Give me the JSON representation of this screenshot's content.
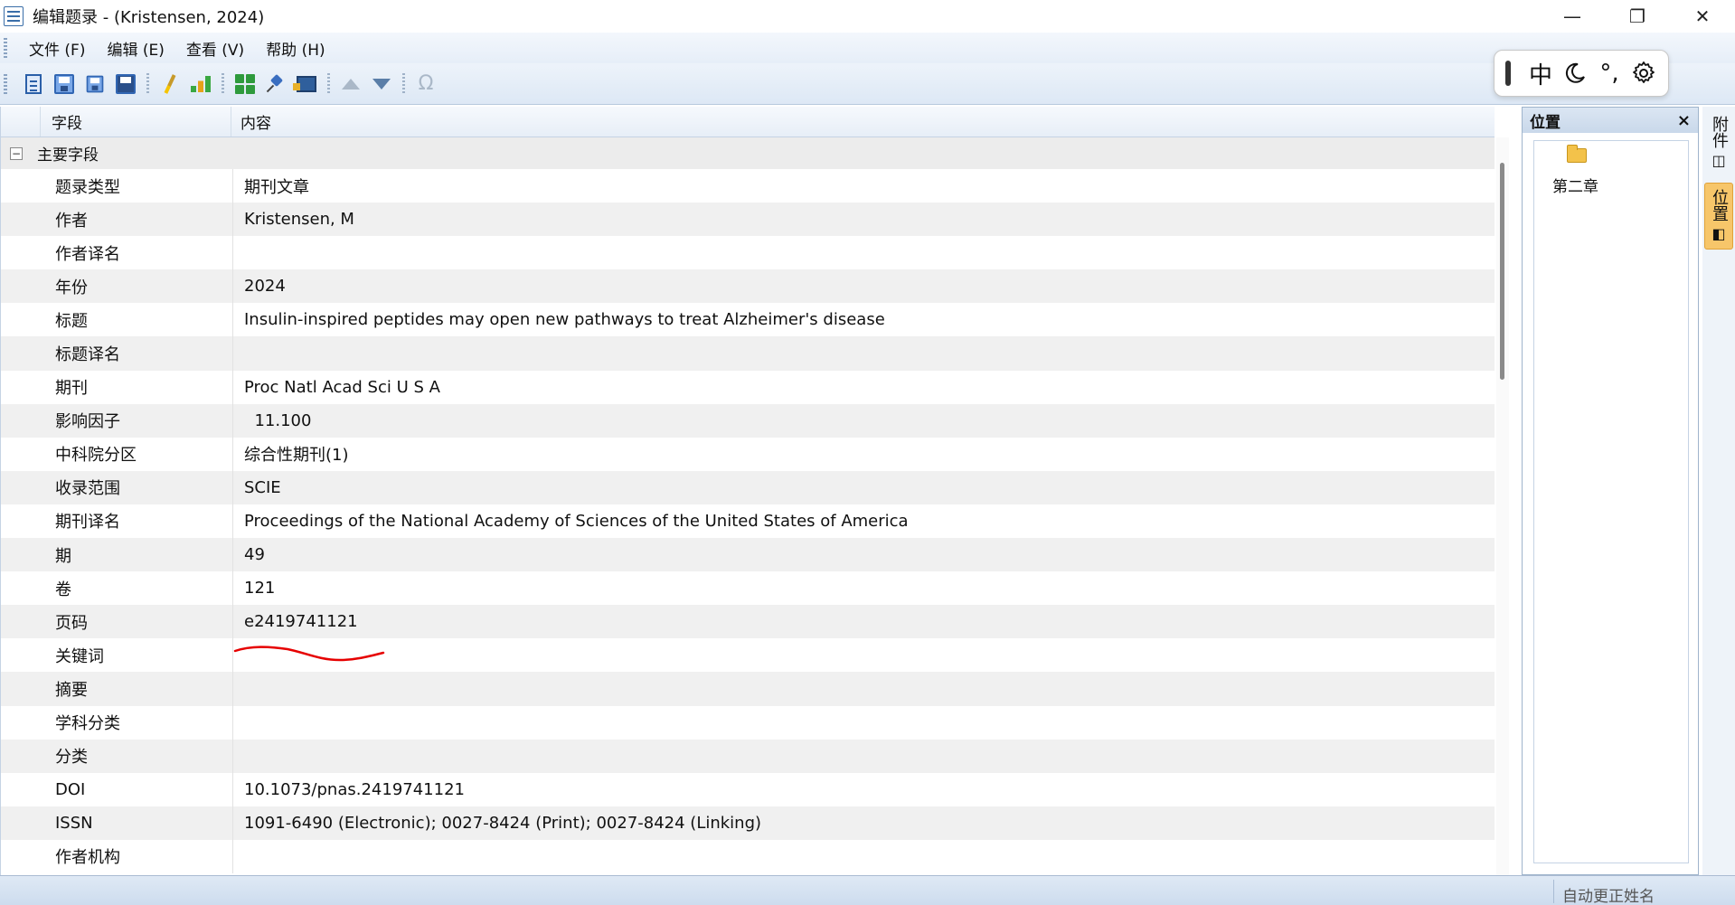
{
  "window": {
    "title": "编辑题录 - (Kristensen, 2024)",
    "minimize": "—",
    "restore": "❐",
    "close": "✕"
  },
  "menu": {
    "items": [
      "文件 (F)",
      "编辑 (E)",
      "查看 (V)",
      "帮助 (H)"
    ]
  },
  "ime": {
    "lang": "中",
    "punct": "°,",
    "mode_icon": "moon-icon",
    "settings_icon": "gear-icon"
  },
  "grid": {
    "header_field": "字段",
    "header_content": "内容",
    "group": "主要字段",
    "collapse_symbol": "−",
    "rows": [
      {
        "label": "题录类型",
        "value": "期刊文章"
      },
      {
        "label": "作者",
        "value": "Kristensen, M"
      },
      {
        "label": "作者译名",
        "value": ""
      },
      {
        "label": "年份",
        "value": "2024"
      },
      {
        "label": "标题",
        "value": "Insulin-inspired peptides may open new pathways to treat Alzheimer's disease"
      },
      {
        "label": "标题译名",
        "value": ""
      },
      {
        "label": "期刊",
        "value": "Proc Natl Acad Sci U S A"
      },
      {
        "label": "影响因子",
        "value": "  11.100"
      },
      {
        "label": "中科院分区",
        "value": "综合性期刊(1)"
      },
      {
        "label": "收录范围",
        "value": "SCIE"
      },
      {
        "label": "期刊译名",
        "value": "Proceedings of the National Academy of Sciences of the United States of America"
      },
      {
        "label": "期",
        "value": "49"
      },
      {
        "label": "卷",
        "value": "121"
      },
      {
        "label": "页码",
        "value": "e2419741121"
      },
      {
        "label": "关键词",
        "value": ""
      },
      {
        "label": "摘要",
        "value": ""
      },
      {
        "label": "学科分类",
        "value": ""
      },
      {
        "label": "分类",
        "value": ""
      },
      {
        "label": "DOI",
        "value": "10.1073/pnas.2419741121"
      },
      {
        "label": "ISSN",
        "value": "1091-6490 (Electronic); 0027-8424 (Print); 0027-8424 (Linking)"
      },
      {
        "label": "作者机构",
        "value": ""
      }
    ]
  },
  "location_panel": {
    "title": "位置",
    "close": "×",
    "node": "第二章"
  },
  "side_tabs": {
    "attachment": "附件",
    "location": "位置"
  },
  "status": {
    "text": "自动更正姓名"
  },
  "colors": {
    "accent": "#3a6ea8",
    "annotation": "#e60000",
    "active_tab": "#f7c66a"
  }
}
